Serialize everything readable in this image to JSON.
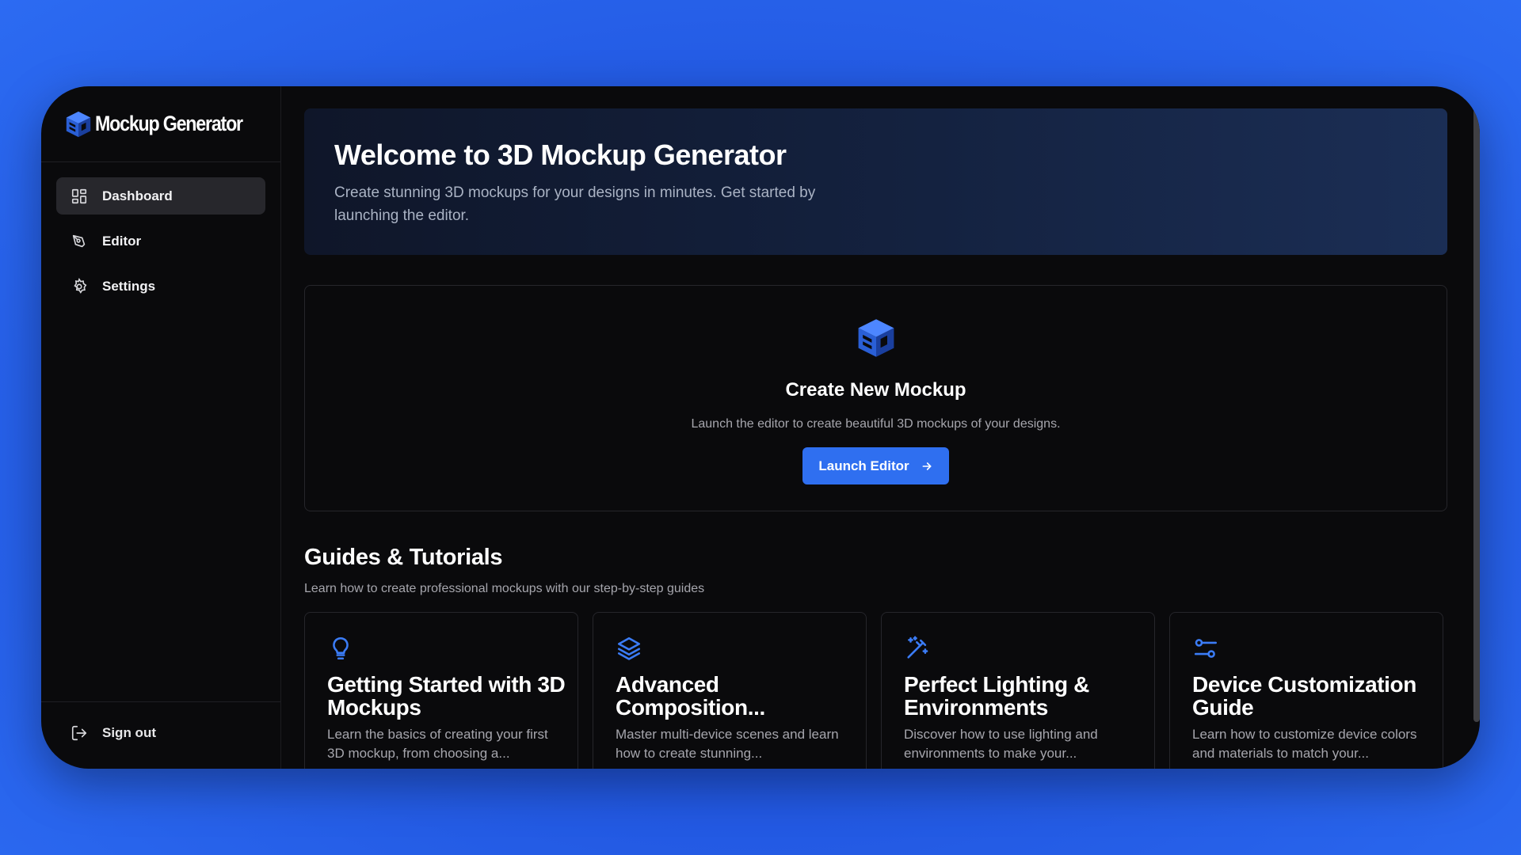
{
  "app": {
    "name": "Mockup Generator"
  },
  "sidebar": {
    "items": [
      {
        "label": "Dashboard",
        "icon": "dashboard-grid-icon",
        "active": true
      },
      {
        "label": "Editor",
        "icon": "pen-tool-icon",
        "active": false
      },
      {
        "label": "Settings",
        "icon": "gear-icon",
        "active": false
      }
    ],
    "signout_label": "Sign out"
  },
  "hero": {
    "title": "Welcome to 3D Mockup Generator",
    "subtitle": "Create stunning 3D mockups for your designs in minutes. Get started by launching the editor."
  },
  "create": {
    "title": "Create New Mockup",
    "subtitle": "Launch the editor to create beautiful 3D mockups of your designs.",
    "button_label": "Launch Editor"
  },
  "guides": {
    "title": "Guides & Tutorials",
    "subtitle": "Learn how to create professional mockups with our step-by-step guides",
    "items": [
      {
        "icon": "lightbulb-icon",
        "title": "Getting Started with 3D Mockups",
        "desc": "Learn the basics of creating your first 3D mockup, from choosing a..."
      },
      {
        "icon": "layers-icon",
        "title": "Advanced Composition...",
        "desc": "Master multi-device scenes and learn how to create stunning..."
      },
      {
        "icon": "magic-wand-icon",
        "title": "Perfect Lighting & Environments",
        "desc": "Discover how to use lighting and environments to make your..."
      },
      {
        "icon": "sliders-icon",
        "title": "Device Customization Guide",
        "desc": "Learn how to customize device colors and materials to match your..."
      }
    ]
  },
  "colors": {
    "accent": "#2f6ff0",
    "background": "#2156e0",
    "window": "#0a0a0c"
  }
}
